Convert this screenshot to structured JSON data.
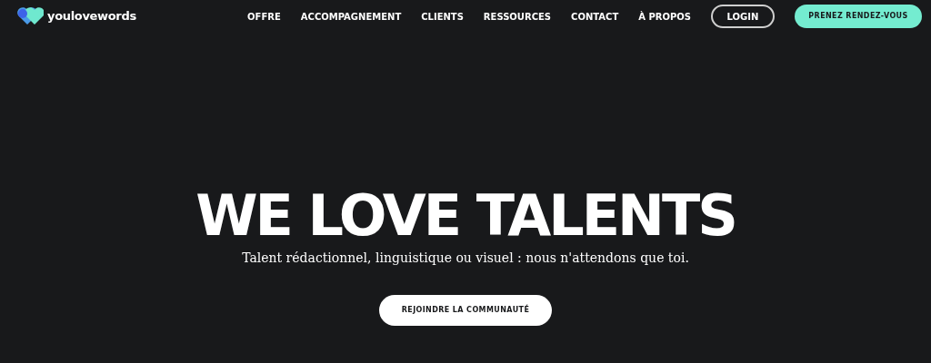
{
  "header": {
    "logo": "youlovewords",
    "nav": [
      "OFFRE",
      "ACCOMPAGNEMENT",
      "CLIENTS",
      "RESSOURCES",
      "CONTACT",
      "À PROPOS"
    ],
    "login": "LOGIN",
    "cta": "PRENEZ RENDEZ-VOUS"
  },
  "hero": {
    "title": "WE LOVE TALENTS",
    "subtitle": "Talent rédactionnel, linguistique ou visuel : nous n'attendons que toi.",
    "button": "REJOINDRE LA COMMUNAUTÉ"
  }
}
